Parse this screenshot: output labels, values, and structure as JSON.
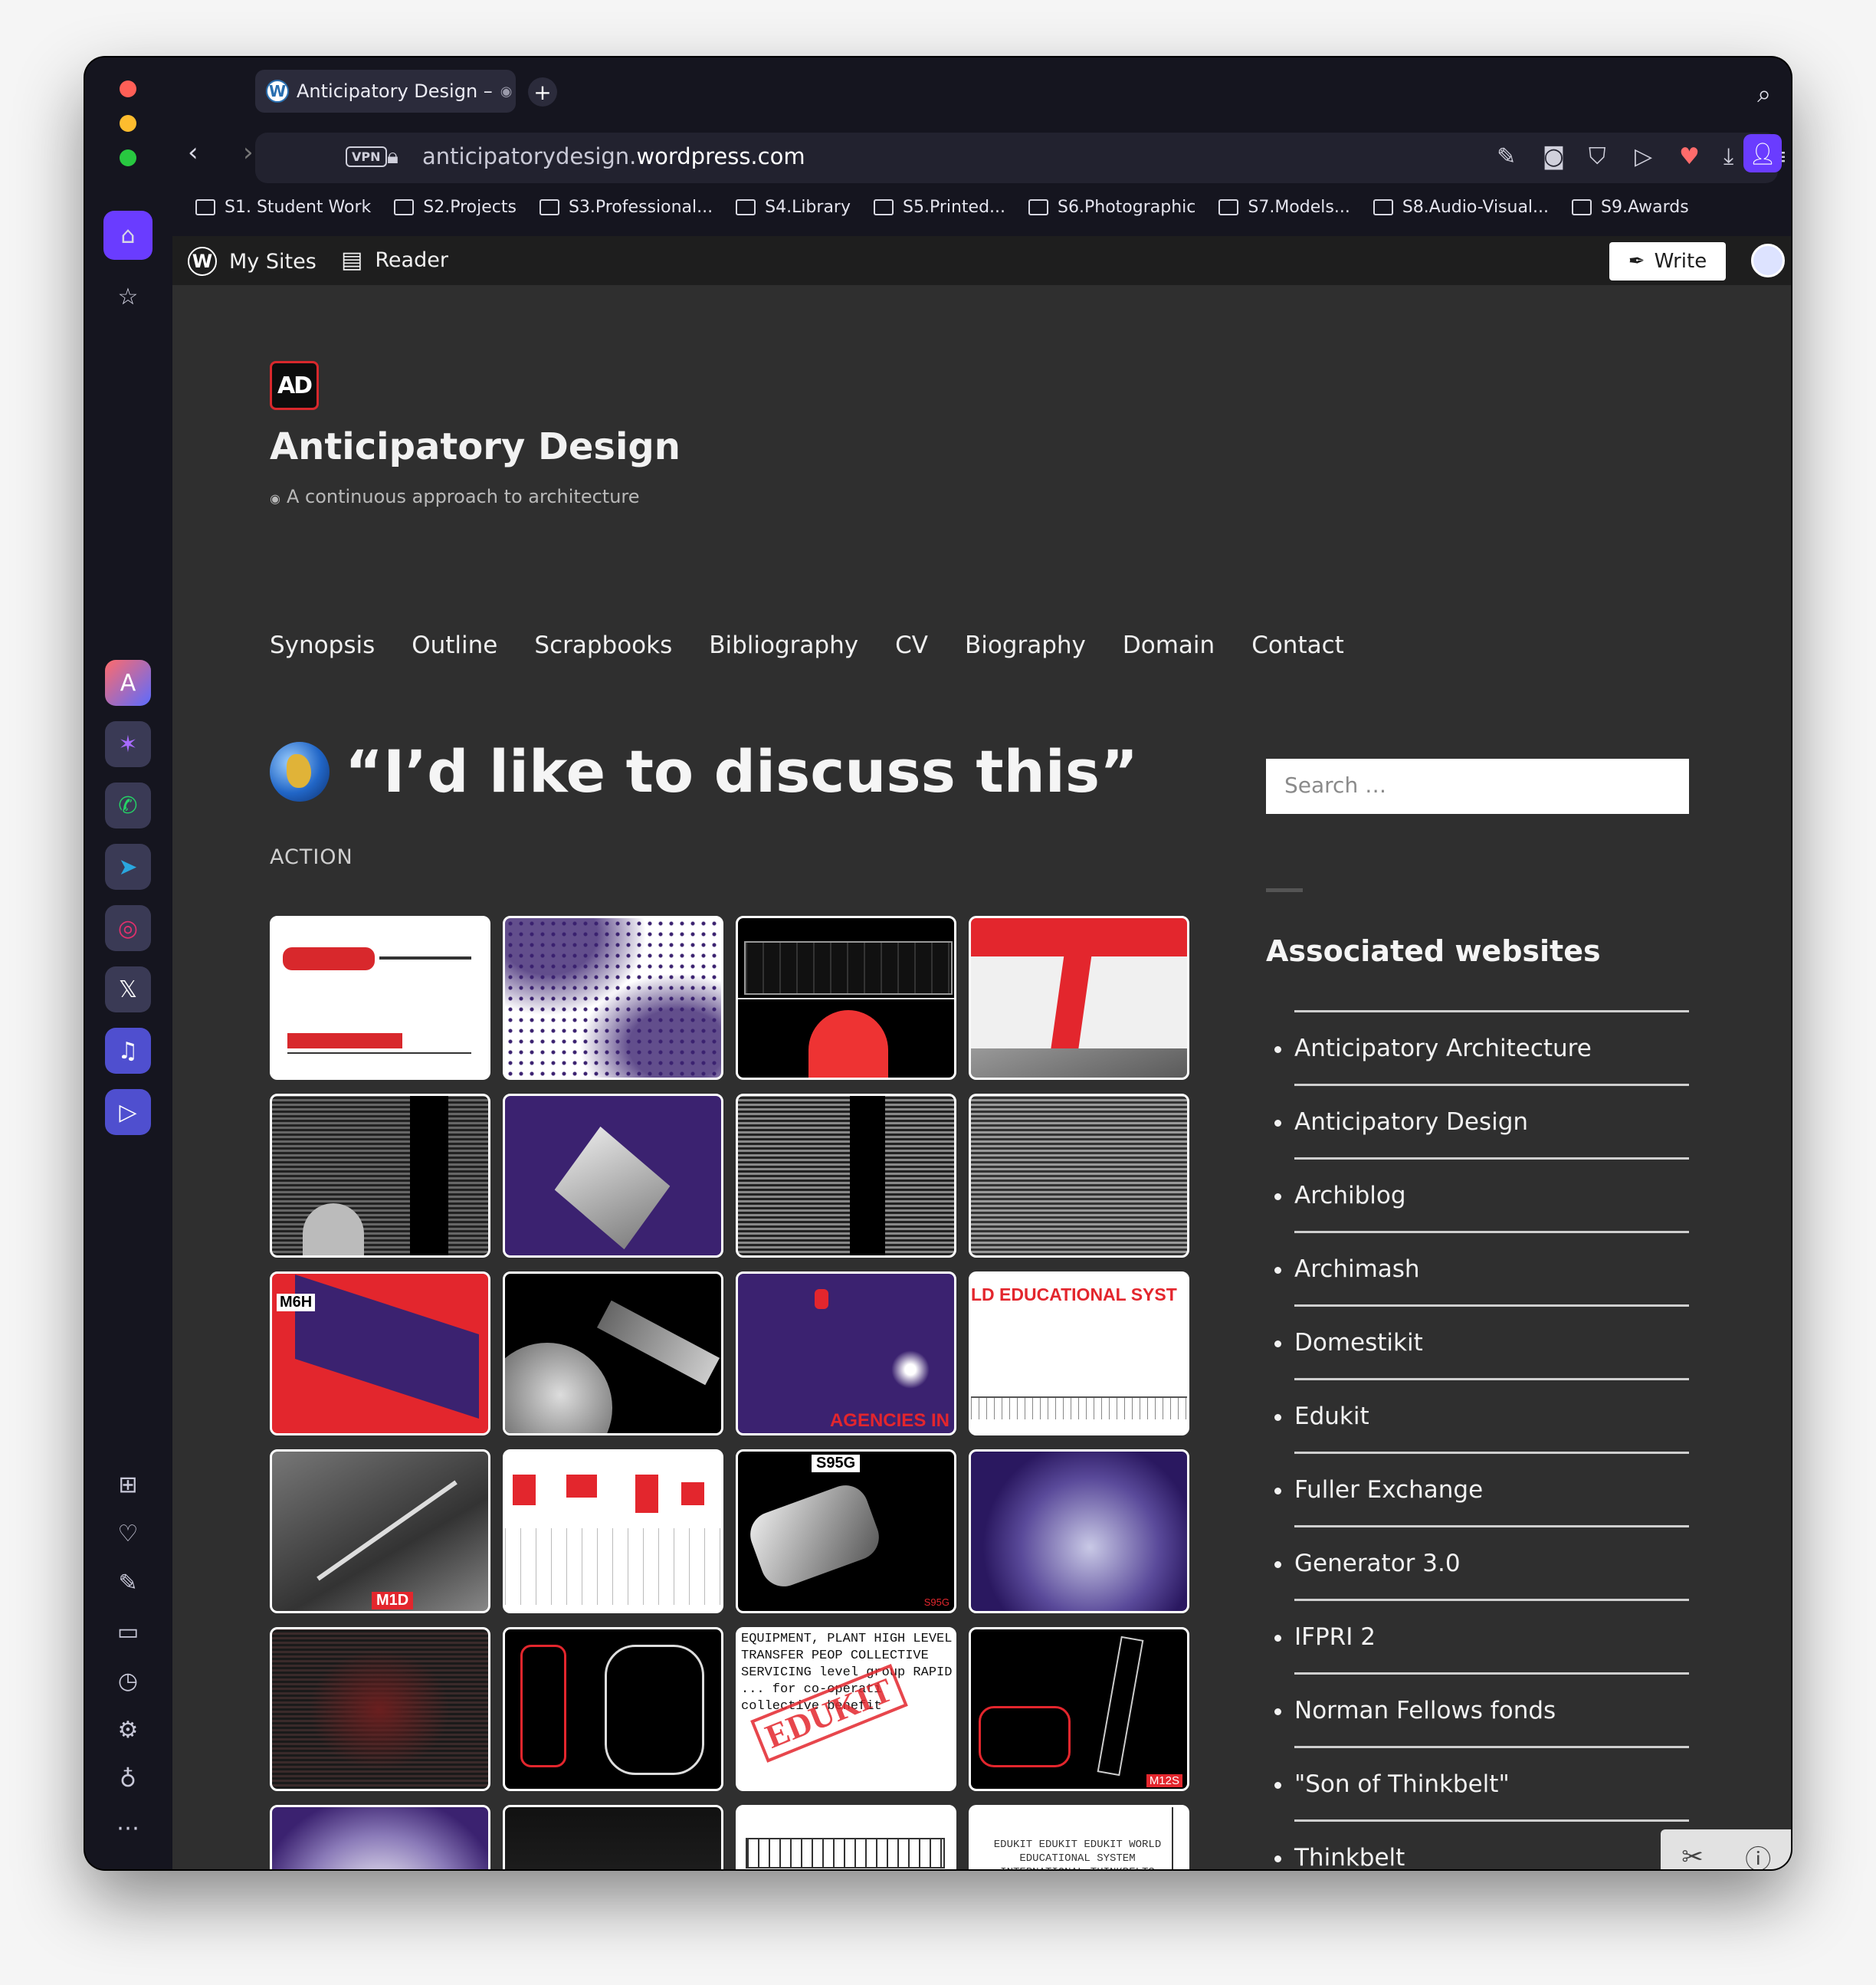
{
  "browser": {
    "tab_title": "Anticipatory Design –",
    "tab_icon": "wordpress-icon",
    "vpn_label": "VPN",
    "url_host_prefix": "anticipatorydesign.",
    "url_host_domain": "wordpress.com",
    "bookmarks": [
      "S1. Student Work",
      "S2.Projects",
      "S3.Professional...",
      "S4.Library",
      "S5.Printed...",
      "S6.Photographic",
      "S7.Models...",
      "S8.Audio-Visual...",
      "S9.Awards"
    ],
    "accent": "#6a3cff"
  },
  "wpbar": {
    "my_sites": "My Sites",
    "reader": "Reader",
    "write": "Write"
  },
  "site": {
    "logo_text": "AD",
    "title": "Anticipatory Design",
    "tagline": "A continuous approach to architecture",
    "menu": [
      "Synopsis",
      "Outline",
      "Scrapbooks",
      "Bibliography",
      "CV",
      "Biography",
      "Domain",
      "Contact"
    ]
  },
  "post": {
    "title": "“I’d like to discuss this”",
    "category": "ACTION",
    "thumb_labels": {
      "t9": "M6H",
      "t11": "AGENCIES IN",
      "t12": "LD EDUCATIONAL SYST",
      "t13": "M1D",
      "t15": "S95G",
      "t15b": "S95G",
      "t17": "EQUIPMENT, PLANT HIGH LEVEL TRANSFER PEOP COLLECTIVE SERVICING level group RAPID ... for co-operati collective benefit",
      "t17_stamp": "EDUKIT",
      "t20": "M12S",
      "t24": "EDUKIT  EDUKIT  EDUKIT WORLD EDUCATIONAL SYSTEM INTERNATIONAL THINKBELTS AGENCIES IN MAJOR CITIES MAIL ORDER REMOTE ACTION UNIQUE MINORITY SERVICES"
    }
  },
  "widgets": {
    "search_placeholder": "Search …",
    "associated_title": "Associated websites",
    "links": [
      "Anticipatory Architecture",
      "Anticipatory Design",
      "Archiblog",
      "Archimash",
      "Domestikit",
      "Edukit",
      "Fuller Exchange",
      "Generator 3.0",
      "IFPRI 2",
      "Norman Fellows fonds",
      "\"Son of Thinkbelt\"",
      "Thinkbelt"
    ]
  }
}
